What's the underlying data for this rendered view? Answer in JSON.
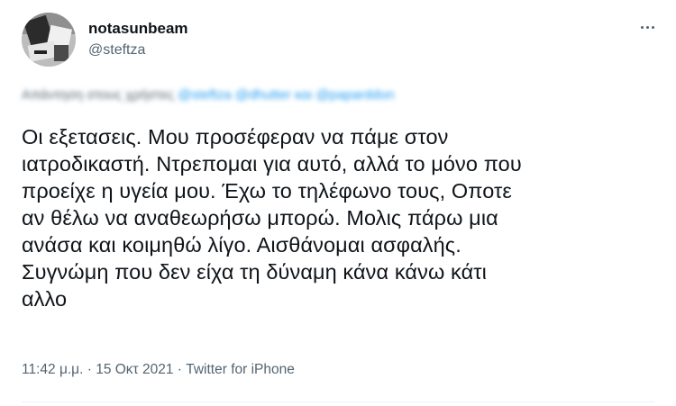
{
  "tweet": {
    "author_name": "notasunbeam",
    "author_handle": "@steftza",
    "reply_prefix": "Απάντηση στους χρήστες",
    "reply_mentions": "@steftza @dhutter και @paparddon",
    "text": "Οι εξετασεις. Μου προσέφεραν να πάμε στον\nιατροδικαστή. Ντρεπομαι για αυτό, αλλά το μόνο που\nπροείχε η υγεία μου. Έχω το τηλέφωνο τους, Οποτε\nαν θέλω να αναθεωρήσω μπορώ. Μολις πάρω μια\nανάσα και κοιμηθώ λίγο. Αισθάνομαι ασφαλής.\nΣυγνώμη που δεν είχα τη δύναμη κάνα κάνω κάτι\nαλλο",
    "time": "11:42 μ.μ.",
    "separator": " · ",
    "date": "15 Οκτ 2021",
    "source": "Twitter for iPhone"
  },
  "icons": {
    "more": "more-horizontal-icon",
    "avatar": "profile-photo"
  }
}
